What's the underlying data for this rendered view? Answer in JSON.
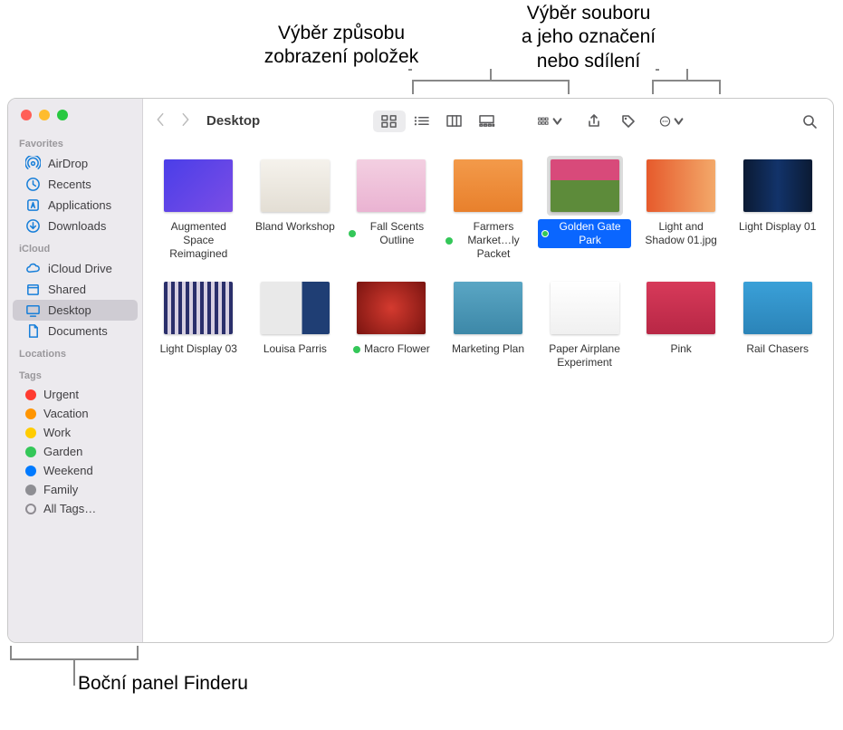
{
  "callouts": {
    "view": "Výběr způsobu\nzobrazení položek",
    "share": "Výběr souboru\na jeho označení\nnebo sdílení",
    "sidebar": "Boční panel Finderu"
  },
  "window": {
    "title": "Desktop"
  },
  "sidebar": {
    "sections": {
      "favorites": "Favorites",
      "icloud": "iCloud",
      "locations": "Locations",
      "tags": "Tags"
    },
    "favorites": [
      {
        "icon": "airdrop-icon",
        "label": "AirDrop"
      },
      {
        "icon": "recents-icon",
        "label": "Recents"
      },
      {
        "icon": "applications-icon",
        "label": "Applications"
      },
      {
        "icon": "downloads-icon",
        "label": "Downloads"
      }
    ],
    "icloud": [
      {
        "icon": "icloud-icon",
        "label": "iCloud Drive"
      },
      {
        "icon": "shared-icon",
        "label": "Shared"
      },
      {
        "icon": "desktop-icon",
        "label": "Desktop",
        "selected": true
      },
      {
        "icon": "documents-icon",
        "label": "Documents"
      }
    ],
    "tags_list": [
      {
        "color": "#ff3b30",
        "label": "Urgent"
      },
      {
        "color": "#ff9500",
        "label": "Vacation"
      },
      {
        "color": "#ffcc00",
        "label": "Work"
      },
      {
        "color": "#34c759",
        "label": "Garden"
      },
      {
        "color": "#007aff",
        "label": "Weekend"
      },
      {
        "color": "#8e8e93",
        "label": "Family"
      }
    ],
    "all_tags": "All Tags…"
  },
  "files": [
    {
      "label": "Augmented Space Reimagined",
      "thumb": "linear-gradient(135deg,#4a3ee8,#7b4de6)",
      "tagged": false
    },
    {
      "label": "Bland Workshop",
      "thumb": "linear-gradient(#f5f2ec,#e3ded4)",
      "tagged": false
    },
    {
      "label": "Fall Scents Outline",
      "thumb": "linear-gradient(#f3cfe1,#eab3d2)",
      "tagged": true
    },
    {
      "label": "Farmers Market…ly Packet",
      "thumb": "linear-gradient(#f39a4a,#e8802c)",
      "tagged": true
    },
    {
      "label": "Golden Gate Park",
      "thumb": "linear-gradient(#d84a7a 0%,#d84a7a 40%,#5d8b3a 40%)",
      "tagged": true,
      "selected": true
    },
    {
      "label": "Light and Shadow 01.jpg",
      "thumb": "linear-gradient(90deg,#e65a2c,#f3a96a)",
      "tagged": false
    },
    {
      "label": "Light Display 01",
      "thumb": "linear-gradient(90deg,#0b1a33,#12336a,#0b1a33)",
      "tagged": false
    },
    {
      "label": "Light Display 03",
      "thumb": "repeating-linear-gradient(90deg,#2a2f6b 0 4px,#d6cfe1 4px 8px)",
      "tagged": false
    },
    {
      "label": "Louisa Parris",
      "thumb": "linear-gradient(90deg,#e9e9e9 60%,#1f3e74 60%)",
      "tagged": false
    },
    {
      "label": "Macro Flower",
      "thumb": "radial-gradient(circle at 50% 50%,#d43a2f,#7a1410)",
      "tagged": true
    },
    {
      "label": "Marketing Plan",
      "thumb": "linear-gradient(#5aa6c4,#3d88a8)",
      "tagged": false
    },
    {
      "label": "Paper Airplane Experiment",
      "thumb": "linear-gradient(#fff,#f0f0f0)",
      "tagged": false
    },
    {
      "label": "Pink",
      "thumb": "linear-gradient(#d73a5a,#b82745)",
      "tagged": false
    },
    {
      "label": "Rail Chasers",
      "thumb": "linear-gradient(#3aa0d8,#2b84b8)",
      "tagged": false
    }
  ]
}
